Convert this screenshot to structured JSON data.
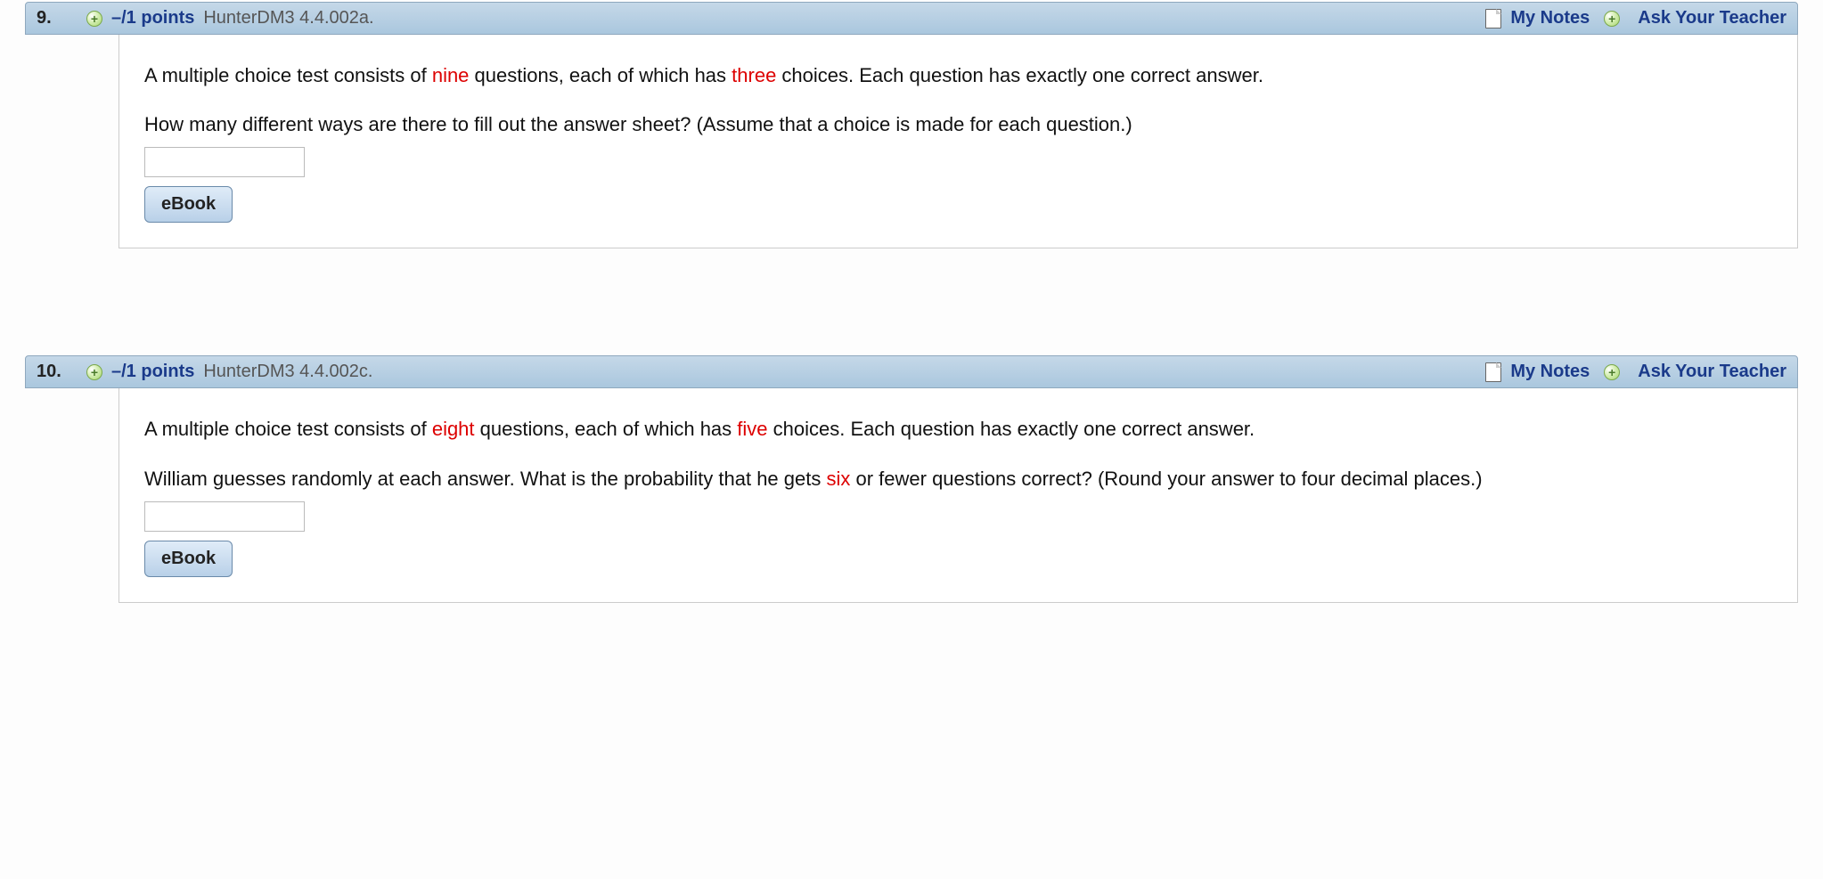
{
  "questions": [
    {
      "number": "9.",
      "points": "–/1 points",
      "source": "HunterDM3 4.4.002a.",
      "my_notes": "My Notes",
      "ask_teacher": "Ask Your Teacher",
      "intro_parts": [
        "A multiple choice test consists of ",
        "nine",
        " questions, each of which has ",
        "three",
        " choices. Each question has exactly one correct answer."
      ],
      "prompt_parts": [
        "How many different ways are there to fill out the answer sheet? (Assume that a choice is made for each question.)"
      ],
      "ebook_label": "eBook"
    },
    {
      "number": "10.",
      "points": "–/1 points",
      "source": "HunterDM3 4.4.002c.",
      "my_notes": "My Notes",
      "ask_teacher": "Ask Your Teacher",
      "intro_parts": [
        "A multiple choice test consists of ",
        "eight",
        " questions, each of which has ",
        "five",
        " choices. Each question has exactly one correct answer."
      ],
      "prompt_parts": [
        "William guesses randomly at each answer. What is the probability that he gets ",
        "six",
        " or fewer questions correct? (Round your answer to four decimal places.)"
      ],
      "ebook_label": "eBook"
    }
  ]
}
